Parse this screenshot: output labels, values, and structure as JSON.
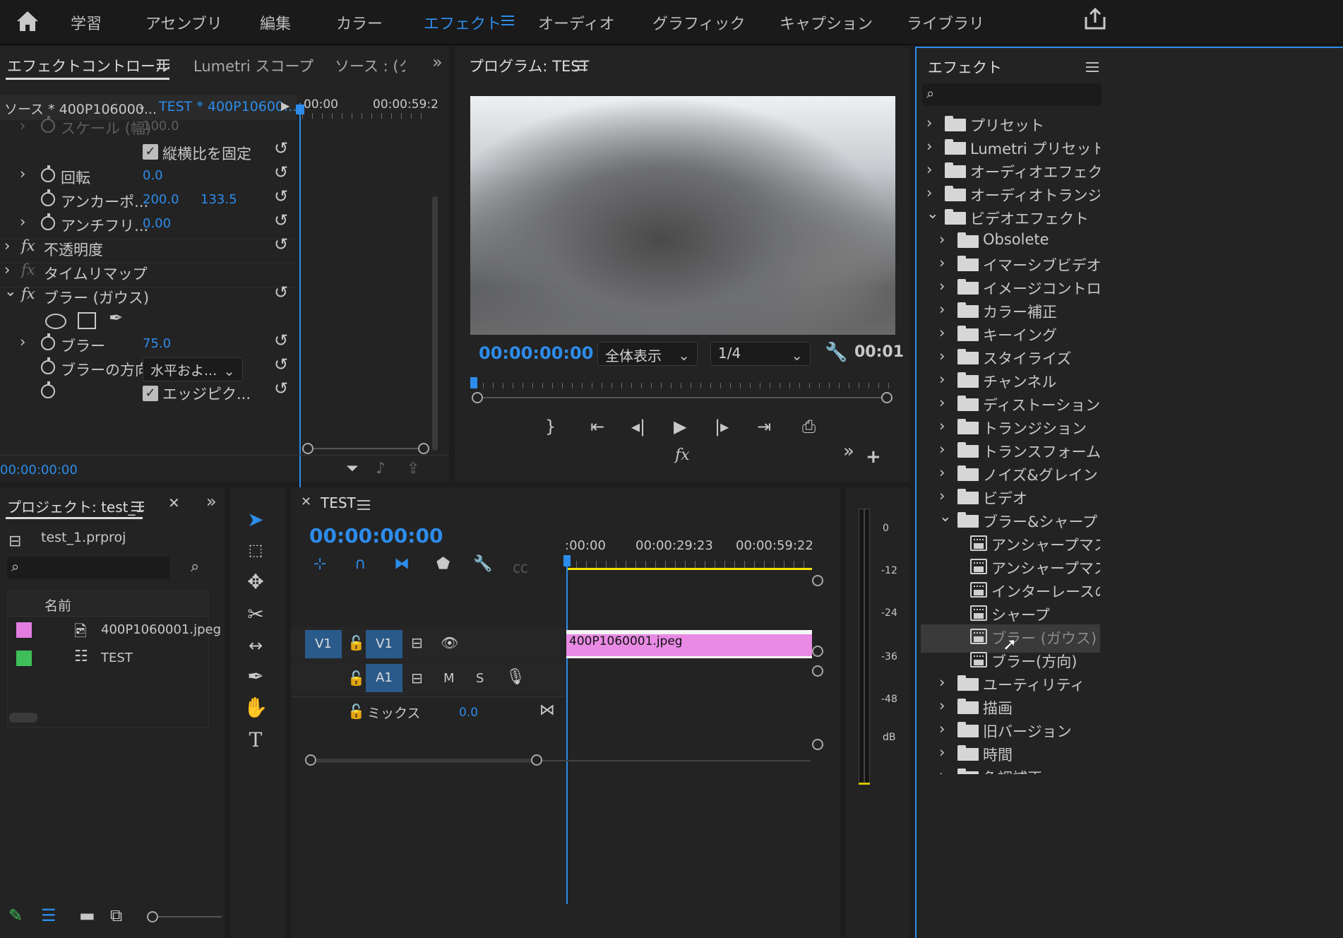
{
  "workspace_tabs": [
    {
      "label": "学習"
    },
    {
      "label": "アセンブリ"
    },
    {
      "label": "編集"
    },
    {
      "label": "カラー"
    },
    {
      "label": "エフェクト"
    },
    {
      "label": "オーディオ"
    },
    {
      "label": "グラフィック"
    },
    {
      "label": "キャプション"
    },
    {
      "label": "ライブラリ"
    }
  ],
  "effect_controls": {
    "tabs": [
      {
        "label": "エフェクトコントロール"
      },
      {
        "label": "Lumetri スコープ"
      },
      {
        "label": "ソース : (ク"
      }
    ],
    "source_label": "ソース * 400P106000...",
    "clip_label": "TEST * 400P10600...",
    "timeline_start": "00:00",
    "timeline_end": "00:00:59:2",
    "rows": {
      "scale_width_label": "スケール (幅)",
      "scale_width_value": "100.0",
      "lock_aspect_label": "縦横比を固定",
      "rotation_label": "回転",
      "rotation_value": "0.0",
      "anchor_label": "アンカーポ...",
      "anchor_x": "200.0",
      "anchor_y": "133.5",
      "antiflicker_label": "アンチフリ...",
      "antiflicker_value": "0.00",
      "opacity_label": "不透明度",
      "timeremap_label": "タイムリマップ",
      "blur_effect_label": "ブラー (ガウス)",
      "blurriness_label": "ブラー",
      "blurriness_value": "75.0",
      "blur_dir_label": "ブラーの方向",
      "blur_dir_value": "水平およ...",
      "edge_label": "エッジピク..."
    },
    "fx_label": "fx",
    "timecode": "00:00:00:00"
  },
  "program": {
    "title": "プログラム: TEST",
    "timecode": "00:00:00:00",
    "zoom": "全体表示",
    "resolution": "1/4",
    "duration": "00:01",
    "fx_label": "fx"
  },
  "effects_panel": {
    "title": "エフェクト",
    "search_placeholder": "",
    "items": [
      {
        "label": "プリセット"
      },
      {
        "label": "Lumetri プリセット"
      },
      {
        "label": "オーディオエフェクト"
      },
      {
        "label": "オーディオトランジシ"
      },
      {
        "label": "ビデオエフェクト"
      },
      {
        "label": "Obsolete"
      },
      {
        "label": "イマーシブビデオ"
      },
      {
        "label": "イメージコントロー"
      },
      {
        "label": "カラー補正"
      },
      {
        "label": "キーイング"
      },
      {
        "label": "スタイライズ"
      },
      {
        "label": "チャンネル"
      },
      {
        "label": "ディストーション"
      },
      {
        "label": "トランジション"
      },
      {
        "label": "トランスフォーム"
      },
      {
        "label": "ノイズ&グレイン"
      },
      {
        "label": "ビデオ"
      },
      {
        "label": "ブラー&シャープ"
      },
      {
        "label": "アンシャープマスク"
      },
      {
        "label": "アンシャープマスク"
      },
      {
        "label": "インターレースの"
      },
      {
        "label": "シャープ"
      },
      {
        "label": "ブラー (ガウス)"
      },
      {
        "label": "ブラー(方向)"
      },
      {
        "label": "ユーティリティ"
      },
      {
        "label": "描画"
      },
      {
        "label": "旧バージョン"
      },
      {
        "label": "時間"
      },
      {
        "label": "色調補正"
      }
    ]
  },
  "project": {
    "title": "プロジェクト: test_1",
    "file": "test_1.prproj",
    "column_name": "名前",
    "items": [
      {
        "label": "400P1060001.jpeg",
        "color": "#e37de0"
      },
      {
        "label": "TEST",
        "color": "#3fbf5a"
      }
    ]
  },
  "timeline": {
    "title": "TEST",
    "timecode": "00:00:00:00",
    "ruler": [
      ":00:00",
      "00:00:29:23",
      "00:00:59:22"
    ],
    "v1_src": "V1",
    "v1": "V1",
    "a1": "A1",
    "mute": "M",
    "solo": "S",
    "mix_label": "ミックス",
    "mix_value": "0.0",
    "clip_label": "400P1060001.jpeg",
    "clip_color": "#e98ae5"
  },
  "meter": {
    "labels": [
      "0",
      "-12",
      "-24",
      "-36",
      "-48",
      "dB"
    ]
  }
}
